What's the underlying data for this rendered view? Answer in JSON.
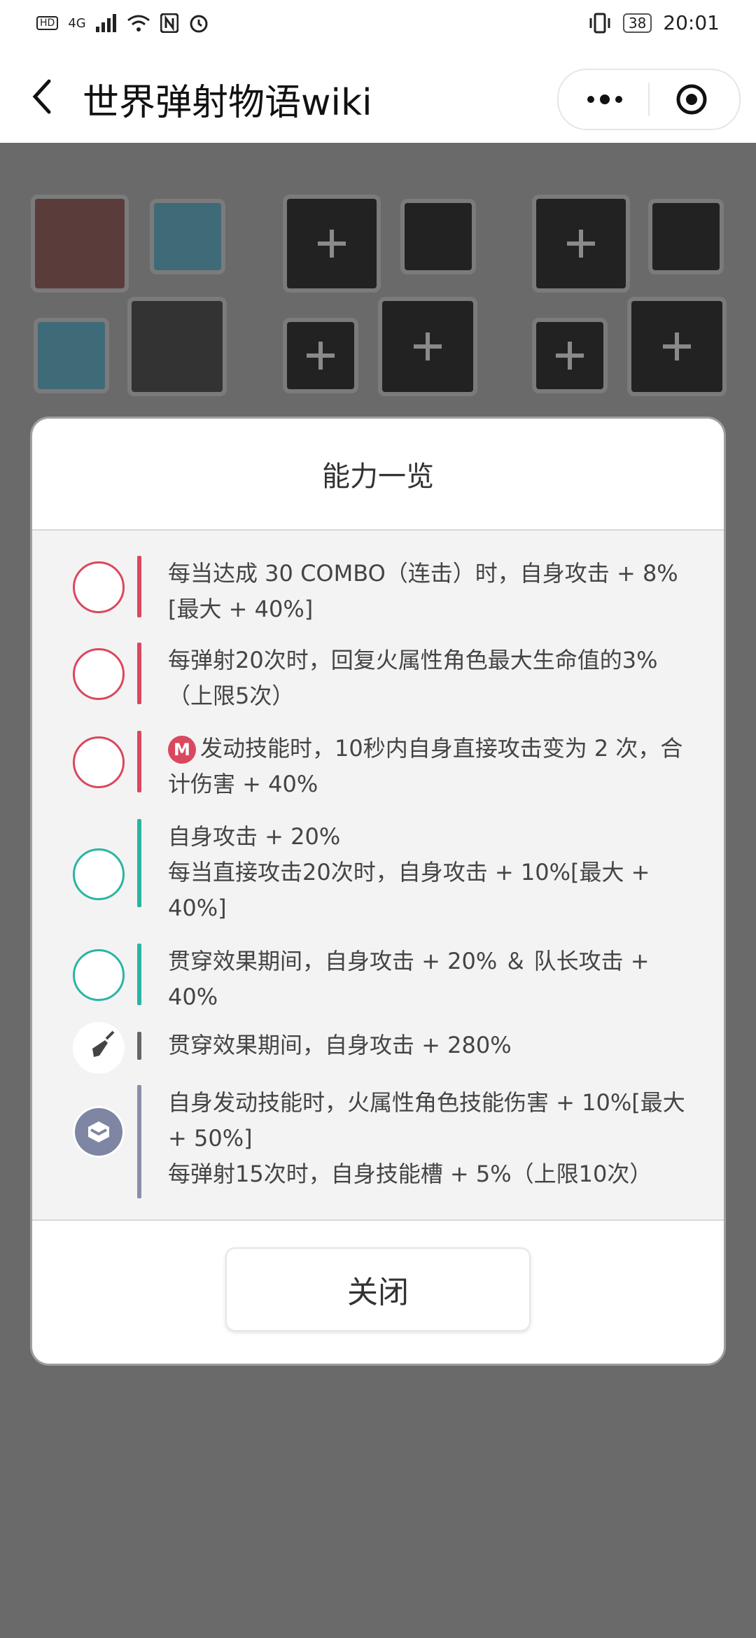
{
  "status_bar": {
    "left_icons": [
      "HD",
      "4G",
      "signal-icon",
      "wifi-icon",
      "nfc-icon",
      "alarm-icon"
    ],
    "battery": "38",
    "time": "20:01"
  },
  "header": {
    "title": "世界弹射物语wiki"
  },
  "modal": {
    "title": "能力一览",
    "items": [
      {
        "icon": "character-red-avatar-icon",
        "accent": "#d9485f",
        "text": "每当达成 30 COMBO（连击）时，自身攻击 + 8%[最大 + 40%]"
      },
      {
        "icon": "character-red-avatar-icon",
        "accent": "#d9485f",
        "text": "每弹射20次时，回复火属性角色最大生命值的3%（上限5次）"
      },
      {
        "icon": "character-red-avatar-icon",
        "accent": "#d9485f",
        "badge": "M",
        "text": "发动技能时，10秒内自身直接攻击变为 2 次，合计伤害 + 40%"
      },
      {
        "icon": "wolf-avatar-icon",
        "accent": "#2ab5a1",
        "text_lines": [
          "自身攻击 + 20%",
          "每当直接攻击20次时，自身攻击 + 10%[最大 + 40%]"
        ]
      },
      {
        "icon": "wolf-avatar-icon",
        "accent": "#2ab5a1",
        "text": "贯穿效果期间，自身攻击 + 20% ＆ 队长攻击 + 40%"
      },
      {
        "icon": "weapon-spear-icon",
        "accent": "#666666",
        "text": "贯穿效果期间，自身攻击 + 280%"
      },
      {
        "icon": "armor-emblem-icon",
        "accent": "#8a8fa8",
        "text_lines": [
          "自身发动技能时，火属性角色技能伤害 + 10%[最大 + 50%]",
          "每弹射15次时，自身技能槽 + 5%（上限10次）"
        ]
      }
    ],
    "close_label": "关闭"
  }
}
